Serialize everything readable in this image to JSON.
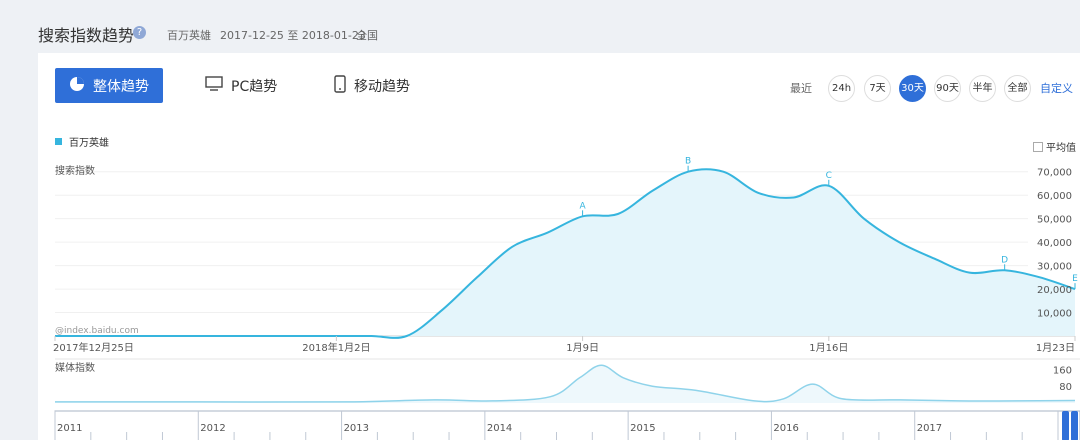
{
  "header": {
    "title": "搜索指数趋势",
    "keyword": "百万英雄",
    "date_range": "2017-12-25 至 2018-01-23",
    "region": "全国"
  },
  "tabs": [
    {
      "label": "整体趋势",
      "icon": "pie-chart-icon",
      "active": true
    },
    {
      "label": "PC趋势",
      "icon": "monitor-icon",
      "active": false
    },
    {
      "label": "移动趋势",
      "icon": "phone-icon",
      "active": false
    }
  ],
  "range": {
    "label": "最近",
    "options": [
      "24h",
      "7天",
      "30天",
      "90天",
      "半年",
      "全部"
    ],
    "selected": "30天",
    "custom": "自定义"
  },
  "legend": {
    "series": "百万英雄"
  },
  "average_label": "平均值",
  "colors": {
    "accent": "#2f6fd8",
    "series": "#36b5de",
    "fill": "#e4f5fb"
  },
  "chart_data": [
    {
      "type": "area",
      "ylabel": "搜索指数",
      "watermark": "@index.baidu.com",
      "yticks": [
        "70,000",
        "60,000",
        "50,000",
        "40,000",
        "30,000",
        "20,000",
        "10,000"
      ],
      "ytick_values": [
        70000,
        60000,
        50000,
        40000,
        30000,
        20000,
        10000
      ],
      "ylim": [
        0,
        75000
      ],
      "xticks": [
        "2017年12月25日",
        "2018年1月2日",
        "1月9日",
        "1月16日",
        "1月23日"
      ],
      "xtick_positions": [
        0,
        8,
        15,
        22,
        29
      ],
      "series": [
        {
          "name": "百万英雄",
          "x": [
            0,
            1,
            2,
            3,
            4,
            5,
            6,
            7,
            8,
            9,
            10,
            11,
            12,
            13,
            14,
            15,
            16,
            17,
            18,
            19,
            20,
            21,
            22,
            23,
            24,
            25,
            26,
            27,
            28,
            29
          ],
          "values": [
            0,
            0,
            0,
            0,
            0,
            0,
            0,
            0,
            0,
            0,
            0,
            11000,
            25000,
            38000,
            44000,
            51000,
            52000,
            62000,
            70000,
            70000,
            61000,
            59000,
            64000,
            50000,
            40000,
            33000,
            27000,
            28000,
            25000,
            20000
          ]
        }
      ],
      "annotations": [
        {
          "label": "A",
          "x": 15
        },
        {
          "label": "B",
          "x": 18
        },
        {
          "label": "C",
          "x": 22
        },
        {
          "label": "D",
          "x": 27
        },
        {
          "label": "E",
          "x": 29
        }
      ]
    },
    {
      "type": "line",
      "ylabel": "媒体指数",
      "yticks": [
        "160",
        "80"
      ],
      "ytick_values": [
        160,
        80
      ],
      "ylim": [
        0,
        200
      ],
      "xticks": [
        "2011",
        "2012",
        "2013",
        "2014",
        "2015",
        "2016",
        "2017"
      ],
      "series": [
        {
          "name": "媒体指数",
          "x": [
            2011.0,
            2012.0,
            2013.0,
            2013.6,
            2014.0,
            2014.4,
            2014.6,
            2014.75,
            2014.9,
            2015.1,
            2015.4,
            2015.8,
            2016.0,
            2016.2,
            2016.4,
            2016.8,
            2017.2,
            2017.6,
            2018.0
          ],
          "values": [
            5,
            5,
            5,
            15,
            10,
            30,
            120,
            180,
            120,
            80,
            60,
            10,
            20,
            90,
            20,
            15,
            10,
            10,
            12
          ]
        }
      ]
    }
  ]
}
